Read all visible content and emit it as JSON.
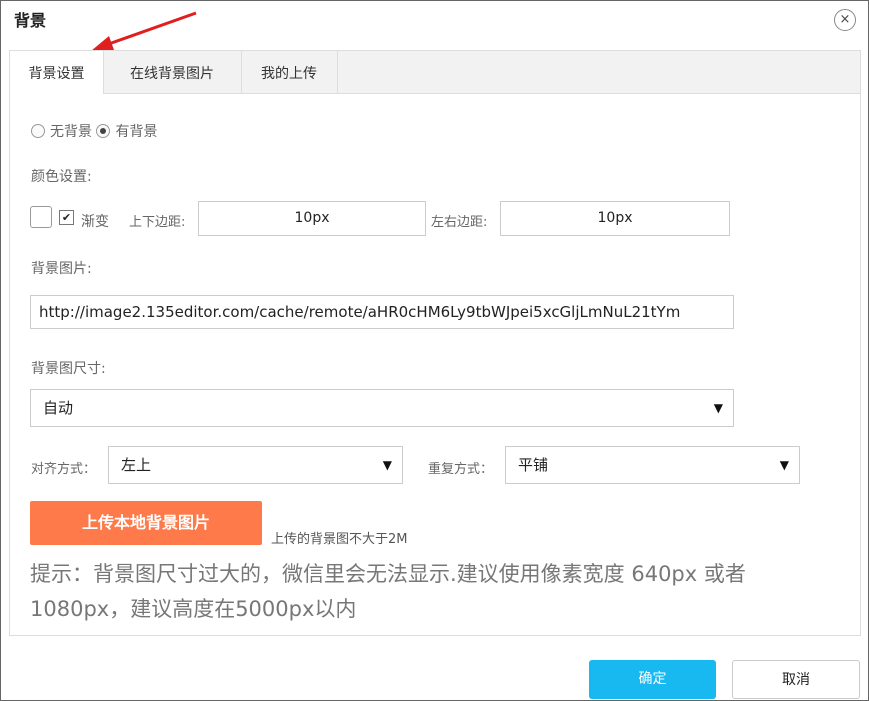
{
  "dialog": {
    "title": "背景",
    "close_symbol": "×"
  },
  "tabs": [
    {
      "label": "背景设置"
    },
    {
      "label": "在线背景图片"
    },
    {
      "label": "我的上传"
    }
  ],
  "background_mode": {
    "no_bg_label": "无背景",
    "has_bg_label": "有背景",
    "selected": "有背景"
  },
  "color_settings": {
    "label": "颜色设置:",
    "gradient_label": "渐变",
    "gradient_checked": true,
    "vertical_margin_label": "上下边距:",
    "vertical_margin_value": "10px",
    "horizontal_margin_label": "左右边距:",
    "horizontal_margin_value": "10px"
  },
  "image": {
    "label": "背景图片:",
    "url": "http://image2.135editor.com/cache/remote/aHR0cHM6Ly9tbWJpei5xcGljLmNuL21tYm"
  },
  "size": {
    "label": "背景图尺寸:",
    "value": "自动"
  },
  "align": {
    "label": "对齐方式：",
    "value": "左上"
  },
  "repeat": {
    "label": "重复方式：",
    "value": "平铺"
  },
  "upload": {
    "button_label": "上传本地背景图片",
    "hint": "上传的背景图不大于2M"
  },
  "tip": "提示：背景图尺寸过大的，微信里会无法显示.建议使用像素宽度 640px 或者 1080px，建议高度在5000px以内",
  "footer": {
    "confirm_label": "确定",
    "cancel_label": "取消"
  },
  "colors": {
    "accent_upload": "#ff7a4a",
    "accent_confirm": "#18b9f0",
    "arrow": "#e02020"
  }
}
